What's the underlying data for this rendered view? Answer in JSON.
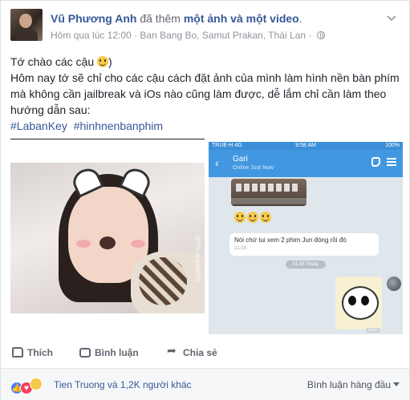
{
  "post": {
    "author": "Vũ Phương Anh",
    "verb": "đã thêm",
    "what": "một ảnh và một video",
    "dot": ".",
    "time": "Hôm qua lúc 12:00",
    "separator": "·",
    "location": "Ban Bang Bo, Samut Prakan, Thái Lan",
    "separator2": "·",
    "options_icon": "chevron-down-icon",
    "privacy_icon": "globe-icon"
  },
  "body": {
    "line1": "Tớ chào các cậu",
    "line1_end": ")",
    "line2": "Hôm nay tớ sẽ chỉ cho các cậu cách đặt ảnh của mình làm hình nền bàn phím mà không cần jailbreak và iOs nào cũng làm được, dễ lắm chỉ cần làm theo hướng dẫn sau:",
    "hashtags": [
      "#LabanKey",
      "#hinhnenbanphim"
    ]
  },
  "phone": {
    "carrier": "TRUE-H",
    "network": "4G",
    "clock": "9:58 AM",
    "battery": "100%",
    "contact": "Gari",
    "contact_status": "Online Just Now",
    "message": "Nói chứ tui xem 2 phim Jun đóng rồi đó",
    "message_time": "21:03",
    "day_label": "01:38 Today",
    "seen": "Seen"
  },
  "video_watermark": "@Phuonganhhh",
  "actions": {
    "like": "Thích",
    "comment": "Bình luận",
    "share": "Chia sẻ"
  },
  "reactions": {
    "summary": "Tien Truong và 1,2K người khác",
    "sort": "Bình luận hàng đầu",
    "types": [
      "like",
      "love",
      "haha"
    ]
  },
  "colors": {
    "link": "#365899",
    "muted": "#90949c",
    "messenger_blue": "#4298e0"
  }
}
